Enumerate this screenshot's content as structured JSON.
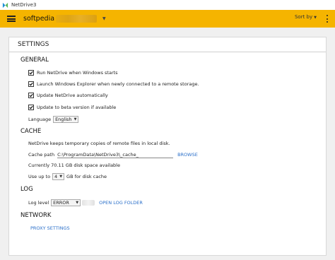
{
  "window": {
    "title": "NetDrive3"
  },
  "toolbar": {
    "account_name": "softpedia",
    "sort_label": "Sort by"
  },
  "settings": {
    "header": "SETTINGS",
    "general": {
      "title": "GENERAL",
      "options": [
        {
          "label": "Run NetDrive when Windows starts",
          "checked": true
        },
        {
          "label": "Launch Windows Explorer when newly connected to a remote storage.",
          "checked": true
        },
        {
          "label": "Update NetDrive automatically",
          "checked": true
        },
        {
          "label": "Update to beta version if available",
          "checked": true
        }
      ],
      "language_label": "Language",
      "language_value": "English"
    },
    "cache": {
      "title": "CACHE",
      "description": "NetDrive keeps temporary copies of remote files in local disk.",
      "path_label": "Cache path",
      "path_value": "C:\\ProgramData\\NetDrive3\\_cache_",
      "browse_label": "BROWSE",
      "space_text": "Currently 70.11 GB disk space available",
      "use_up_to_label": "Use up to",
      "use_up_to_value": "4",
      "use_up_to_suffix": "GB for disk cache"
    },
    "log": {
      "title": "LOG",
      "level_label": "Log level",
      "level_value": "ERROR",
      "open_folder_label": "OPEN LOG FOLDER"
    },
    "network": {
      "title": "NETWORK",
      "proxy_label": "PROXY SETTINGS"
    }
  },
  "colors": {
    "toolbar": "#f5b400",
    "link": "#2a6fc9"
  },
  "icons": {
    "app": "netdrive-logo-icon",
    "menu": "hamburger-icon",
    "more": "more-vertical-icon"
  }
}
